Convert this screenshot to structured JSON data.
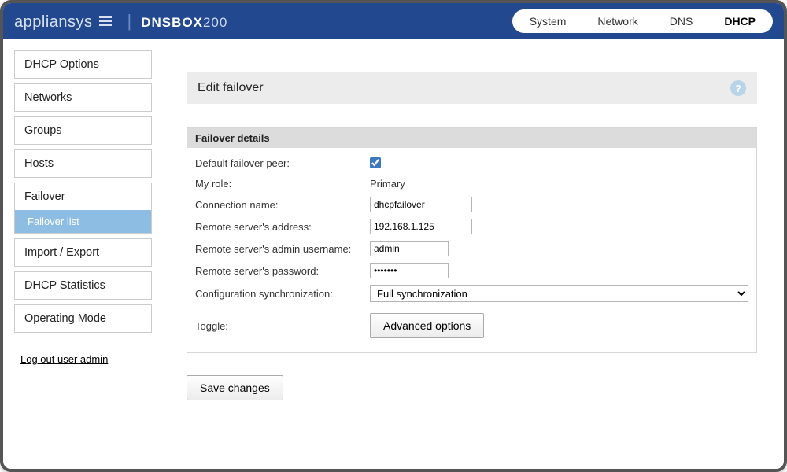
{
  "brand": {
    "name": "appliansys",
    "product_bold": "DNSBOX",
    "product_thin": "200"
  },
  "topnav": {
    "items": [
      "System",
      "Network",
      "DNS",
      "DHCP"
    ],
    "active_index": 3
  },
  "sidebar": {
    "items": [
      {
        "label": "DHCP Options"
      },
      {
        "label": "Networks"
      },
      {
        "label": "Groups"
      },
      {
        "label": "Hosts"
      },
      {
        "label": "Failover",
        "children": [
          {
            "label": "Failover list"
          }
        ]
      },
      {
        "label": "Import / Export"
      },
      {
        "label": "DHCP Statistics"
      },
      {
        "label": "Operating Mode"
      }
    ],
    "logout": "Log out user admin"
  },
  "panel": {
    "title": "Edit failover",
    "help_glyph": "?",
    "section_title": "Failover details",
    "rows": {
      "default_peer": {
        "label": "Default failover peer:",
        "checked": true
      },
      "role": {
        "label": "My role:",
        "value": "Primary"
      },
      "conn": {
        "label": "Connection name:",
        "value": "dhcpfailover"
      },
      "addr": {
        "label": "Remote server's address:",
        "value": "192.168.1.125"
      },
      "user": {
        "label": "Remote server's admin username:",
        "value": "admin"
      },
      "pass": {
        "label": "Remote server's password:",
        "value": "•••••••"
      },
      "sync": {
        "label": "Configuration synchronization:",
        "value": "Full synchronization"
      },
      "toggle": {
        "label": "Toggle:",
        "button": "Advanced options"
      }
    },
    "save_label": "Save changes"
  }
}
